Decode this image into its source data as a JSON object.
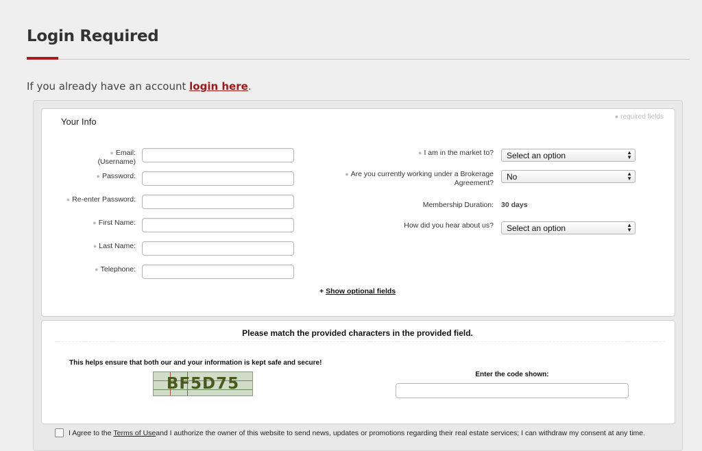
{
  "page": {
    "title": "Login Required",
    "intro_prefix": "If you already have an account ",
    "intro_link": "login here",
    "intro_suffix": "."
  },
  "colors": {
    "accent": "#a81b1b",
    "background": "#efefef"
  },
  "your_info": {
    "title": "Your Info",
    "required_note": "required fields",
    "fields": {
      "email_label": "Email:",
      "email_sub": "(Username)",
      "password_label": "Password:",
      "reenter_label": "Re-enter Password:",
      "first_name_label": "First Name:",
      "last_name_label": "Last Name:",
      "telephone_label": "Telephone:"
    },
    "right": {
      "market_label": "I am in the market to?",
      "market_value": "Select an option",
      "brokerage_label_1": "Are you currently working under a Brokerage",
      "brokerage_label_2": "Agreement?",
      "brokerage_value": "No",
      "membership_label": "Membership Duration:",
      "membership_value": "30 days",
      "hear_label": "How did you hear about us?",
      "hear_value": "Select an option"
    },
    "show_optional_prefix": "+ ",
    "show_optional": "Show optional fields"
  },
  "captcha": {
    "heading": "Please match the provided characters in the provided field.",
    "help": "This helps ensure that both our and your information is kept safe and secure!",
    "code": "BF5D75",
    "code_label": "Enter the code shown:"
  },
  "agreement": {
    "prefix": "I Agree to the ",
    "terms_link": "Terms of Use",
    "suffix": " and I authorize the owner of this website to send news, updates or promotions regarding their real estate services; I can withdraw my consent at any time."
  },
  "icons": {
    "required_marker": "bullet-dot",
    "select_arrows": "updown-arrows-icon"
  }
}
